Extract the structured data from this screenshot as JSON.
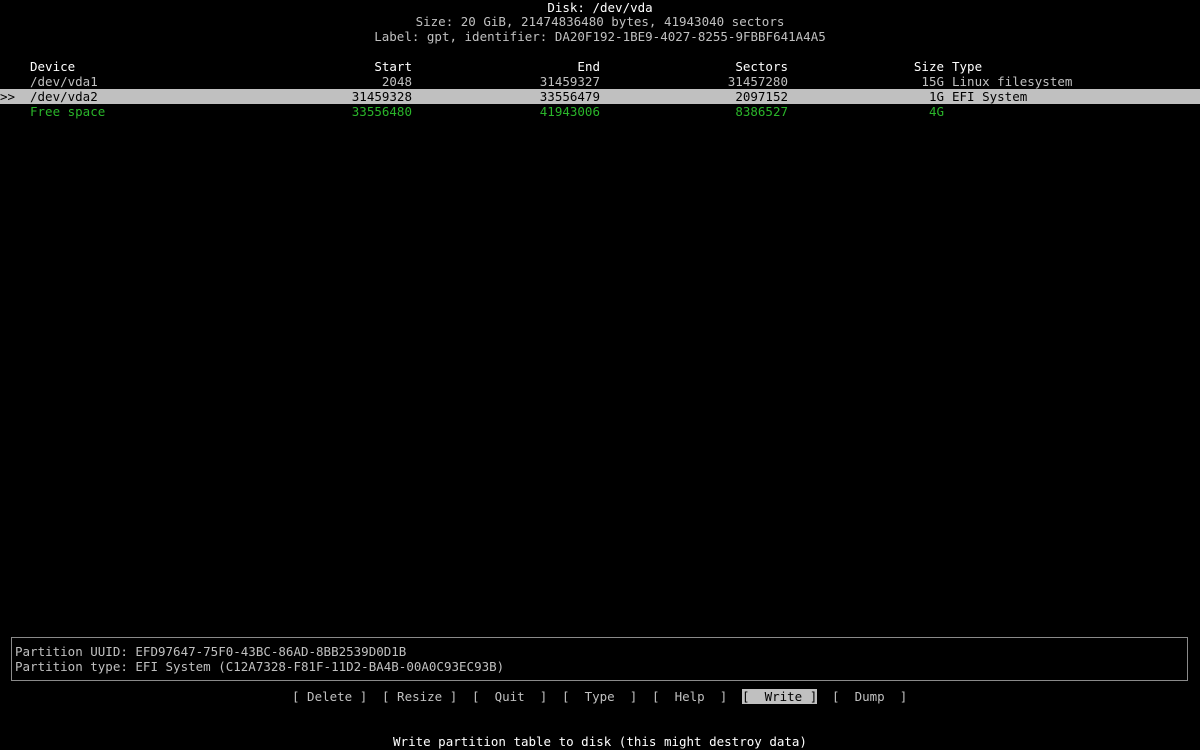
{
  "header": {
    "title": "Disk: /dev/vda",
    "size_line": "Size: 20 GiB, 21474836480 bytes, 41943040 sectors",
    "label_line": "Label: gpt, identifier: DA20F192-1BE9-4027-8255-9FBBF641A4A5"
  },
  "table": {
    "columns": {
      "device": "Device",
      "start": "Start",
      "end": "End",
      "sectors": "Sectors",
      "size": "Size",
      "type": "Type"
    },
    "rows": [
      {
        "marker": "",
        "device": "/dev/vda1",
        "start": "2048",
        "end": "31459327",
        "sectors": "31457280",
        "size": "15G",
        "type": "Linux filesystem"
      },
      {
        "marker": ">>",
        "device": "/dev/vda2",
        "start": "31459328",
        "end": "33556479",
        "sectors": "2097152",
        "size": "1G",
        "type": "EFI System"
      },
      {
        "marker": "",
        "device": "Free space",
        "start": "33556480",
        "end": "41943006",
        "sectors": "8386527",
        "size": "4G",
        "type": ""
      }
    ]
  },
  "info": {
    "uuid_line": "Partition UUID: EFD97647-75F0-43BC-86AD-8BB2539D0D1B",
    "type_line": "Partition type: EFI System (C12A7328-F81F-11D2-BA4B-00A0C93EC93B)"
  },
  "menu": {
    "delete": "[ Delete ]",
    "resize": "[ Resize ]",
    "quit": "[  Quit  ]",
    "type": "[  Type  ]",
    "help": "[  Help  ]",
    "write": "[  Write ]",
    "dump": "[  Dump  ]"
  },
  "status": "Write partition table to disk (this might destroy data)",
  "colors": {
    "background": "#000000",
    "text": "#c0c0c0",
    "highlight": "#c0c0c0",
    "free_space": "#2ab52a",
    "border": "#8a8a8a"
  }
}
